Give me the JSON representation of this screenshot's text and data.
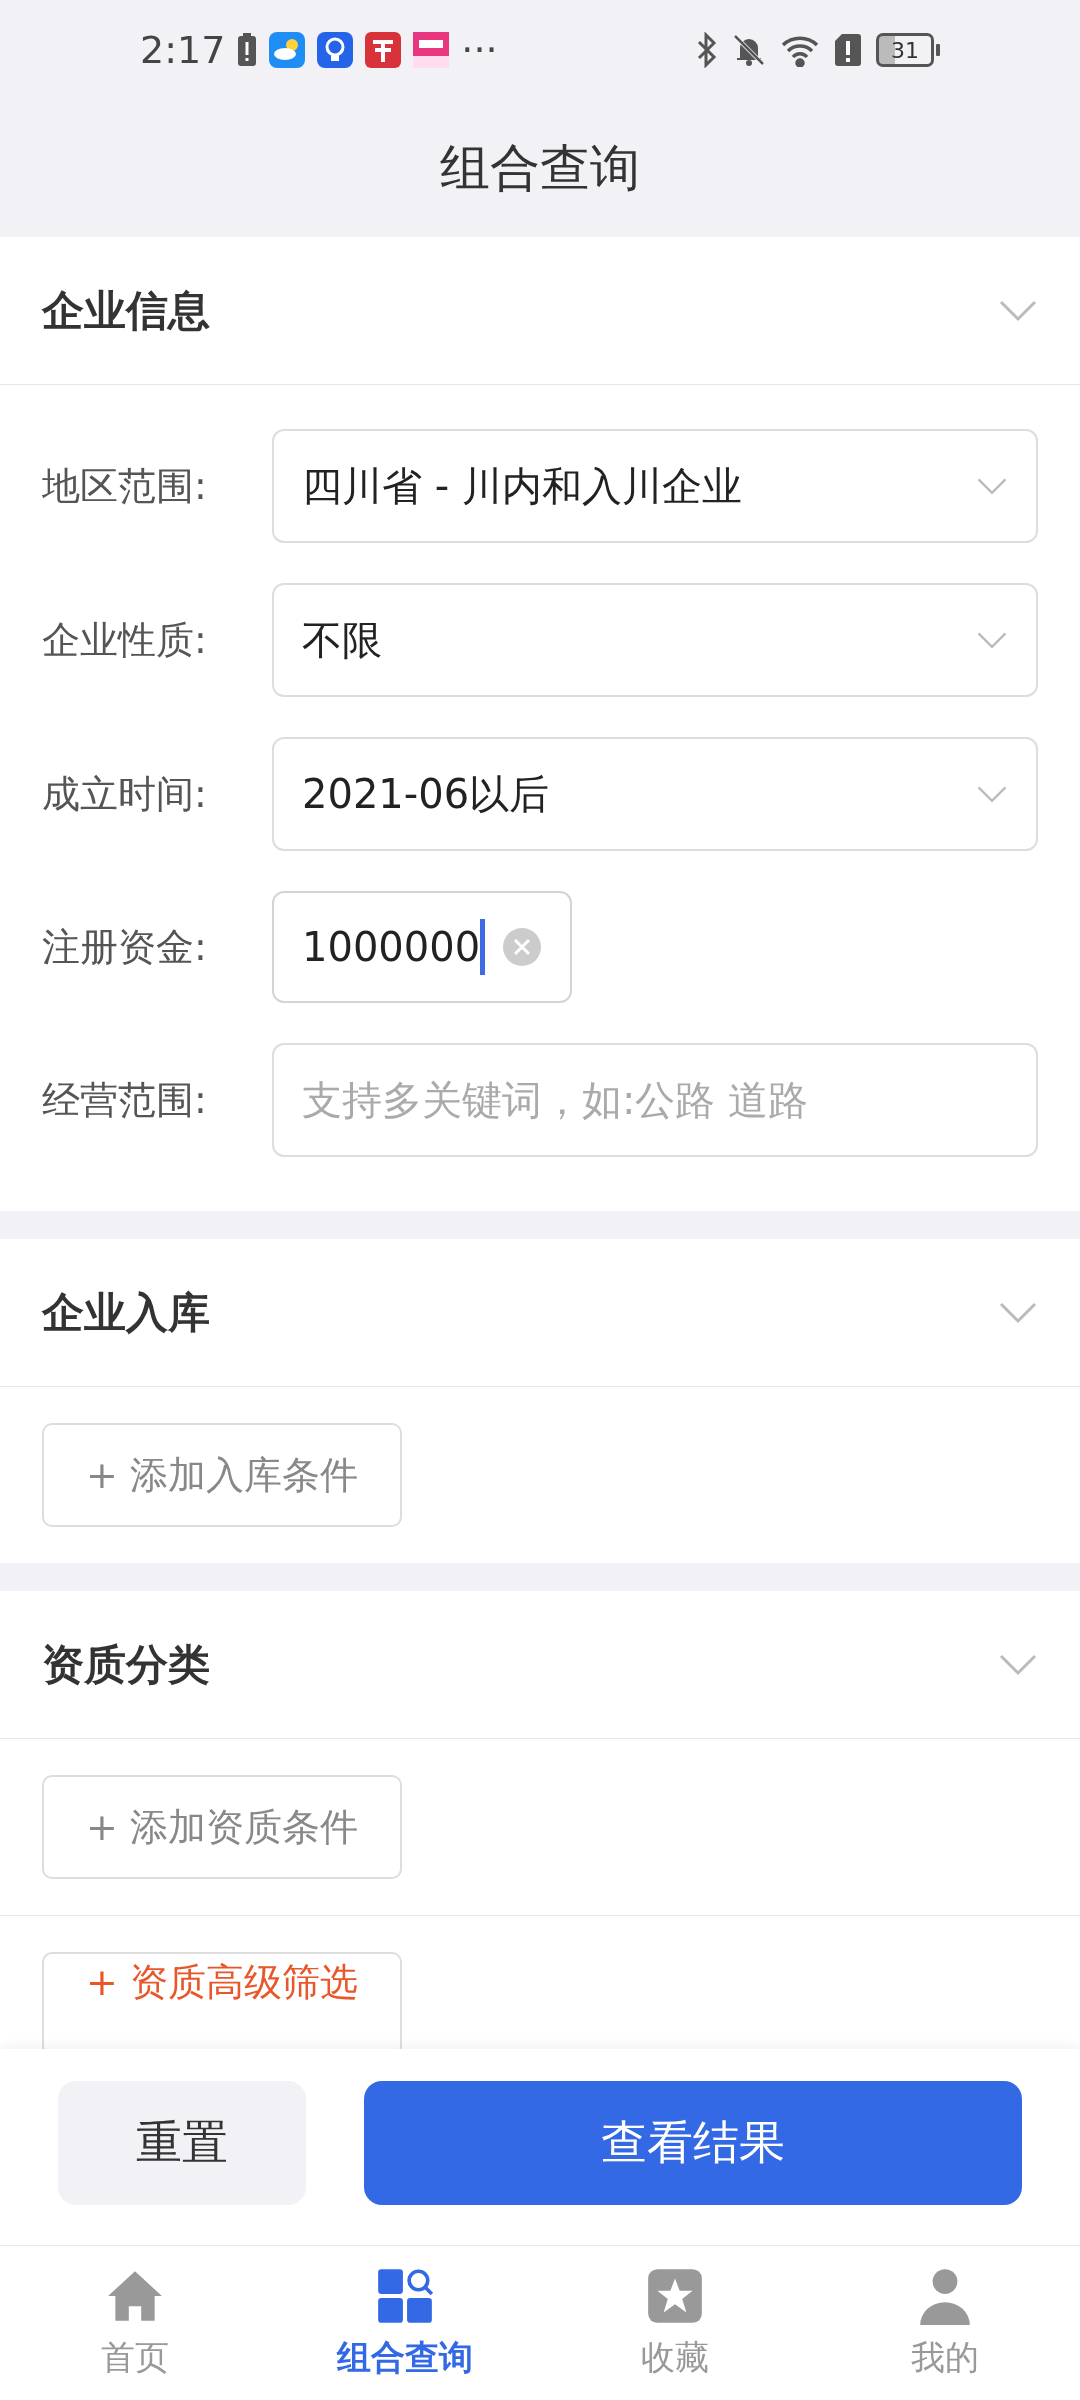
{
  "status_bar": {
    "time": "2:17",
    "more": "···",
    "battery": "31"
  },
  "title": "组合查询",
  "sections": [
    {
      "title": "企业信息",
      "fields": [
        {
          "kind": "select",
          "label": "地区范围:",
          "value": "四川省 - 川内和入川企业"
        },
        {
          "kind": "select",
          "label": "企业性质:",
          "value": "不限"
        },
        {
          "kind": "select",
          "label": "成立时间:",
          "value": "2021-06以后"
        },
        {
          "kind": "input",
          "label": "注册资金:",
          "value": "1000000",
          "focused": true
        },
        {
          "kind": "input",
          "label": "经营范围:",
          "placeholder": "支持多关键词，如:公路 道路",
          "focused": false
        }
      ]
    },
    {
      "title": "企业入库",
      "buttons": [
        {
          "kind": "plain",
          "label": "+ 添加入库条件"
        }
      ]
    },
    {
      "title": "资质分类",
      "buttons": [
        {
          "kind": "plain",
          "label": "+ 添加资质条件"
        },
        {
          "kind": "accent",
          "label": "+ 资质高级筛选"
        }
      ]
    }
  ],
  "actions": [
    {
      "kind": "secondary",
      "label": "重置"
    },
    {
      "kind": "primary",
      "label": "查看结果"
    }
  ],
  "tabs": [
    {
      "label": "首页",
      "selected": false
    },
    {
      "label": "组合查询",
      "selected": true
    },
    {
      "label": "收藏",
      "selected": false
    },
    {
      "label": "我的",
      "selected": false
    }
  ]
}
